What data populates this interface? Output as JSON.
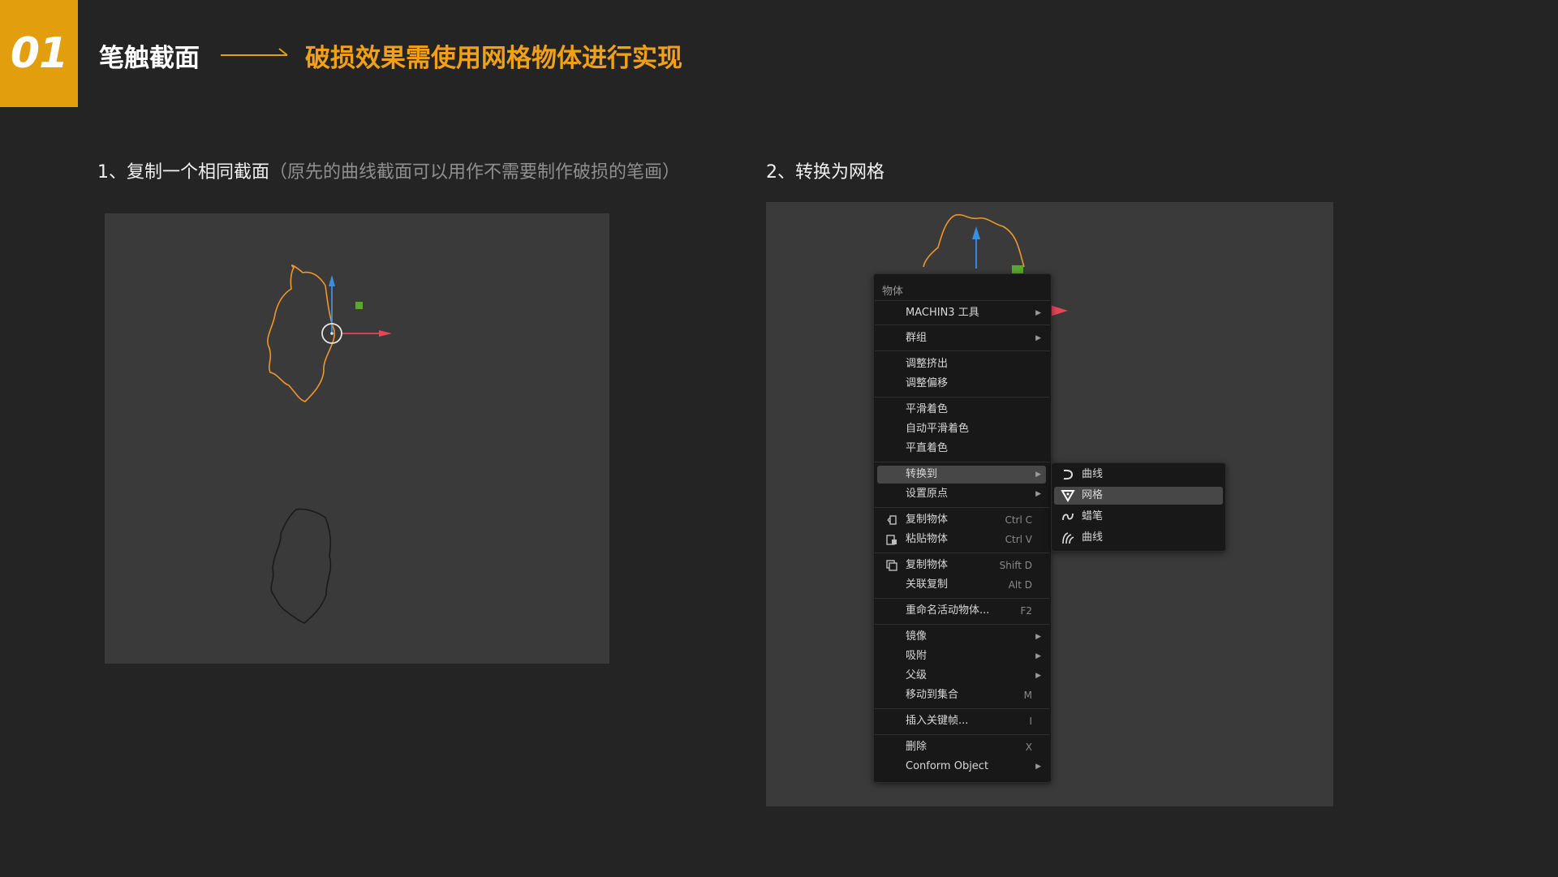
{
  "header": {
    "badge": "01",
    "title": "笔触截面",
    "subtitle": "破损效果需使用网格物体进行实现",
    "accent_color": "#e39e0d"
  },
  "steps": {
    "step1": {
      "main": "1、复制一个相同截面",
      "note": "（原先的曲线截面可以用作不需要制作破损的笔画）"
    },
    "step2": {
      "main": "2、转换为网格"
    }
  },
  "context_menu": {
    "title": "物体",
    "items": [
      {
        "label": "MACHIN3 工具",
        "submenu": true
      },
      {
        "label": "群组",
        "submenu": true
      },
      {
        "label": "调整挤出"
      },
      {
        "label": "调整偏移"
      },
      {
        "label": "平滑着色"
      },
      {
        "label": "自动平滑着色"
      },
      {
        "label": "平直着色"
      },
      {
        "label": "转换到",
        "submenu": true,
        "selected": true
      },
      {
        "label": "设置原点",
        "submenu": true
      },
      {
        "label": "复制物体",
        "shortcut": "Ctrl C",
        "icon": "copy-icon"
      },
      {
        "label": "粘贴物体",
        "shortcut": "Ctrl V",
        "icon": "paste-icon"
      },
      {
        "label": "复制物体",
        "shortcut": "Shift D",
        "icon": "duplicate-icon"
      },
      {
        "label": "关联复制",
        "shortcut": "Alt D"
      },
      {
        "label": "重命名活动物体...",
        "shortcut": "F2"
      },
      {
        "label": "镜像",
        "submenu": true
      },
      {
        "label": "吸附",
        "submenu": true
      },
      {
        "label": "父级",
        "submenu": true
      },
      {
        "label": "移动到集合",
        "shortcut": "M"
      },
      {
        "label": "插入关键帧...",
        "shortcut": "I"
      },
      {
        "label": "删除",
        "shortcut": "X"
      },
      {
        "label": "Conform Object",
        "submenu": true
      }
    ]
  },
  "submenu": {
    "items": [
      {
        "label": "曲线",
        "icon": "curve-icon"
      },
      {
        "label": "网格",
        "icon": "mesh-icon",
        "selected": true
      },
      {
        "label": "蜡笔",
        "icon": "grease-pencil-icon"
      },
      {
        "label": "曲线",
        "icon": "curves-icon"
      }
    ]
  },
  "colors": {
    "selected_outline": "#f0962a",
    "axis_x": "#e8445a",
    "axis_y": "#3c8fe0",
    "handle": "#5aa830"
  }
}
